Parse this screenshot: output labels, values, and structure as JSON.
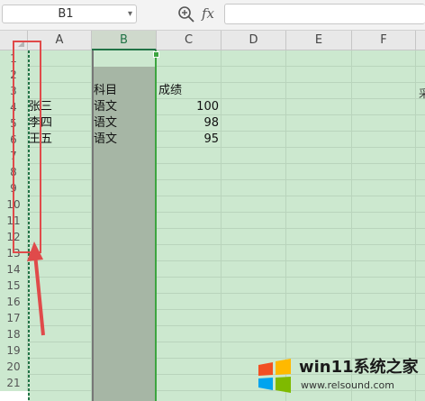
{
  "formula_bar": {
    "name_box": "B1",
    "zoom_icon": "zoom-search-icon",
    "fx_label": "fx",
    "formula": ""
  },
  "columns": [
    "A",
    "B",
    "C",
    "D",
    "E",
    "F"
  ],
  "selected_column": "B",
  "rows": [
    "1",
    "2",
    "3",
    "4",
    "5",
    "6",
    "7",
    "8",
    "9",
    "10",
    "11",
    "12",
    "13",
    "14",
    "15",
    "16",
    "17",
    "18",
    "19",
    "20",
    "21"
  ],
  "cells": {
    "b3": "科目",
    "c3": "成绩",
    "a4": "张三",
    "b4": "语文",
    "c4": "100",
    "a5": "李四",
    "b5": "语文",
    "c5": "98",
    "a6": "王五",
    "b6": "语文",
    "c6": "95"
  },
  "partial_right_text": "采",
  "colors": {
    "sheet_bg": "#cce8cf",
    "selection_fill": "#a6b6a5",
    "active_border": "#3da540",
    "annotation_red": "#e04a4a"
  },
  "watermark": {
    "title": "win11系统之家",
    "url": "www.relsound.com"
  }
}
